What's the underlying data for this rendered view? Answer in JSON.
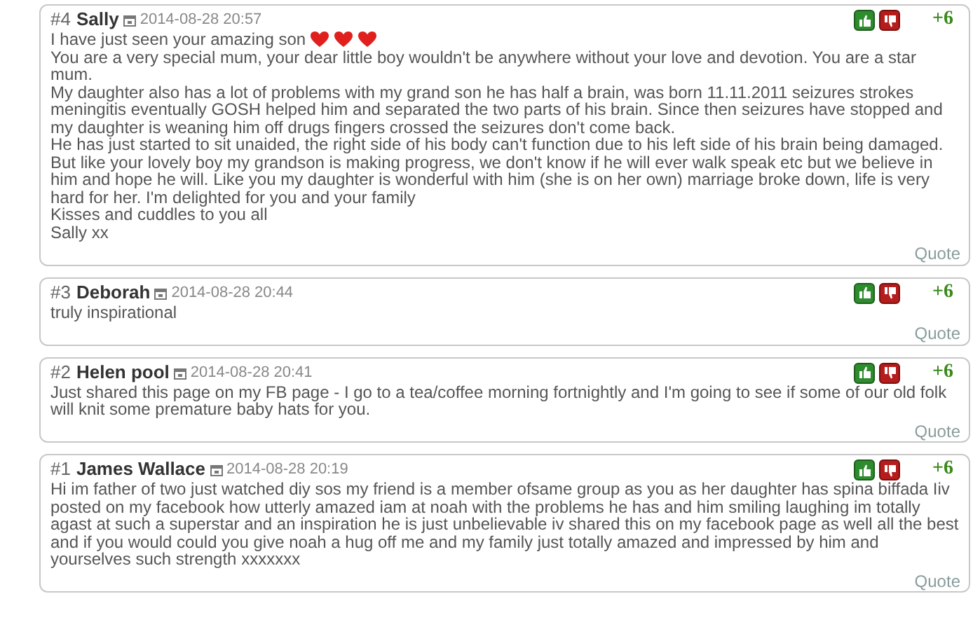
{
  "comments": [
    {
      "number": "#4",
      "author": "Sally",
      "date": "2014-08-28 20:57",
      "score": "+6",
      "quote": "Quote",
      "paragraphs": [
        {
          "text": "I have just seen your amazing son",
          "emoticons": [
            {
              "kind": "heart"
            },
            {
              "kind": "heart"
            },
            {
              "kind": "heart"
            }
          ]
        },
        {
          "text": "You are a very special mum, your dear little boy wouldn't be anywhere without your love and devotion. You are a star mum."
        },
        {
          "text": "My daughter also has a lot of problems with my grand son he has half a brain, was born 11.11.2011 seizures strokes meningitis eventually GOSH helped him and separated the two parts of his brain. Since then seizures have stopped and my daughter is weaning him off drugs fingers crossed the seizures don't come back."
        },
        {
          "text": "He has just started to sit unaided, the right side of his body can't function due to his left side of his brain being damaged. But like your lovely boy my grandson is making progress, we don't know if he will ever walk speak etc but we believe in him and hope he will. Like you my daughter is wonderful with him (she is on her own) marriage broke down, life is very hard for her. I'm delighted for you and your family"
        },
        {
          "text": "Kisses and cuddles to you all"
        },
        {
          "text": "Sally xx"
        }
      ]
    },
    {
      "number": "#3",
      "author": "Deborah",
      "date": "2014-08-28 20:44",
      "score": "+6",
      "quote": "Quote",
      "paragraphs": [
        {
          "text": "truly inspirational"
        }
      ]
    },
    {
      "number": "#2",
      "author": "Helen pool",
      "date": "2014-08-28 20:41",
      "score": "+6",
      "quote": "Quote",
      "paragraphs": [
        {
          "text": "Just shared this page on my FB page - I go to a tea/coffee morning fortnightly and I'm going to see if some of our old folk will knit some premature baby hats for you."
        }
      ]
    },
    {
      "number": "#1",
      "author": "James Wallace",
      "date": "2014-08-28 20:19",
      "score": "+6",
      "quote": "Quote",
      "paragraphs": [
        {
          "text": "Hi im father of two just watched diy sos my friend is a member ofsame group as you as her daughter has spina biffada Iiv posted on my facebook how utterly amazed iam at noah with the problems he has and him smiling laughing im totally agast at such a superstar and an inspiration he is just unbelievable iv shared this on my facebook page as well all the best and if you would could you give noah a hug off me and my family just totally amazed and impressed by him and yourselves such strength xxxxxxx"
        }
      ]
    }
  ]
}
